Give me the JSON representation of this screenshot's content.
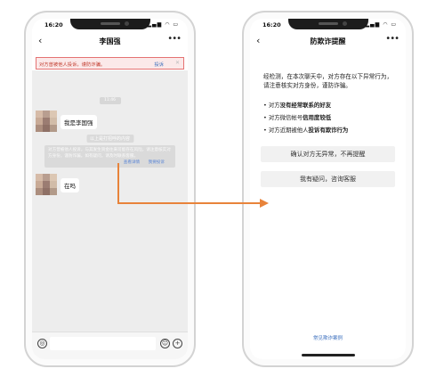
{
  "status_time": "16:20",
  "status_icons": "▂▄▆ ◠ ▭",
  "left_phone": {
    "title": "李国强",
    "warning": {
      "text": "对方曾被他人投诉，谨防诈骗。",
      "link": "投诉"
    },
    "timestamp": "11:46",
    "messages": [
      "我是李国强",
      "在吗"
    ],
    "system_tip": "以上是打招呼的内容",
    "notice": {
      "text": "对方曾被他人投诉，与其发生资金往来可能存在风险。请注意核实对方身份，谨防诈骗。如有疑问，请及时联系客服。",
      "link_check": "查看详情",
      "link_report": "我要投诉"
    }
  },
  "right_phone": {
    "title": "防欺诈提醒",
    "content": "经检测，在本次聊天中，对方存在以下异常行为，请注意核实对方身份，谨防诈骗。",
    "bullets": [
      {
        "prefix": "对方",
        "bold": "没有经常联系的好友"
      },
      {
        "prefix": "对方微信帐号",
        "bold": "信用度较低"
      },
      {
        "prefix": "对方近期被他人",
        "bold": "投诉有欺诈行为"
      }
    ],
    "button_confirm": "确认对方无异常，不再提醒",
    "button_consult": "我有疑问，咨询客服",
    "cases_link": "常见欺诈案例"
  },
  "colors": {
    "arrow": "#e8833a",
    "warning_border": "#e57373",
    "link": "#3a6ebd"
  }
}
